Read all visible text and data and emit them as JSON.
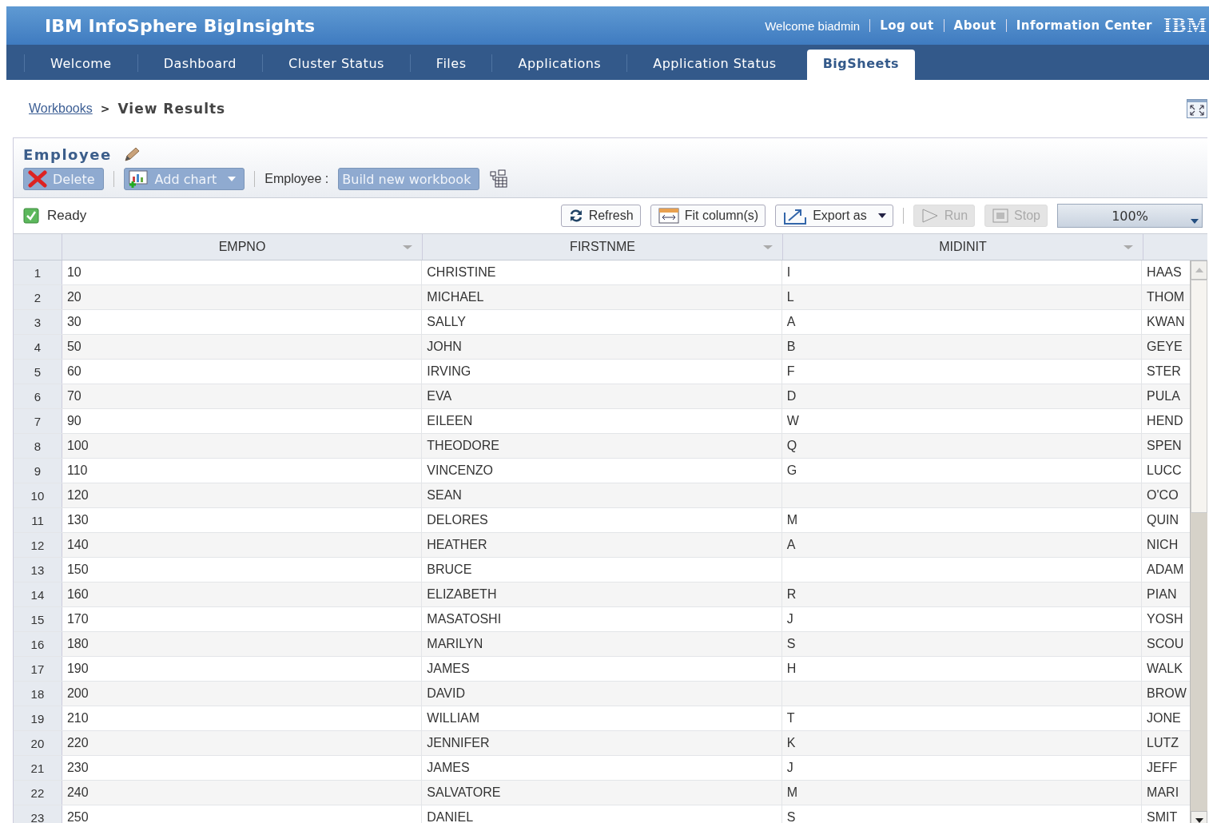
{
  "header": {
    "title": "IBM InfoSphere BigInsights",
    "welcome": "Welcome biadmin",
    "links": [
      "Log out",
      "About",
      "Information Center"
    ],
    "logo": "IBM"
  },
  "tabs": [
    {
      "label": "Welcome",
      "selected": false
    },
    {
      "label": "Dashboard",
      "selected": false
    },
    {
      "label": "Cluster Status",
      "selected": false
    },
    {
      "label": "Files",
      "selected": false
    },
    {
      "label": "Applications",
      "selected": false
    },
    {
      "label": "Application Status",
      "selected": false
    },
    {
      "label": "BigSheets",
      "selected": true
    }
  ],
  "breadcrumb": {
    "link": "Workbooks",
    "separator": ">",
    "current": "View Results"
  },
  "workbook": {
    "title": "Employee",
    "delete": "Delete",
    "add_chart": "Add chart",
    "source_label": "Employee :",
    "build": "Build new workbook"
  },
  "status": {
    "text": "Ready"
  },
  "actions": [
    {
      "kind": "refresh",
      "label": "Refresh",
      "disabled": false
    },
    {
      "kind": "fit",
      "label": "Fit column(s)",
      "disabled": false
    },
    {
      "kind": "export",
      "label": "Export as",
      "disabled": false
    },
    {
      "kind": "run",
      "label": "Run",
      "disabled": true
    },
    {
      "kind": "stop",
      "label": "Stop",
      "disabled": true
    }
  ],
  "zoom": "100%",
  "table": {
    "columns": [
      "EMPNO",
      "FIRSTNME",
      "MIDINIT"
    ],
    "rows": [
      {
        "num": "1",
        "empno": "10",
        "firstnme": "CHRISTINE",
        "midinit": "I",
        "column_4": "HAAS"
      },
      {
        "num": "2",
        "empno": "20",
        "firstnme": "MICHAEL",
        "midinit": "L",
        "column_4": "THOM"
      },
      {
        "num": "3",
        "empno": "30",
        "firstnme": "SALLY",
        "midinit": "A",
        "column_4": "KWAN"
      },
      {
        "num": "4",
        "empno": "50",
        "firstnme": "JOHN",
        "midinit": "B",
        "column_4": "GEYE"
      },
      {
        "num": "5",
        "empno": "60",
        "firstnme": "IRVING",
        "midinit": "F",
        "column_4": "STER"
      },
      {
        "num": "6",
        "empno": "70",
        "firstnme": "EVA",
        "midinit": "D",
        "column_4": "PULA"
      },
      {
        "num": "7",
        "empno": "90",
        "firstnme": "EILEEN",
        "midinit": "W",
        "column_4": "HEND"
      },
      {
        "num": "8",
        "empno": "100",
        "firstnme": "THEODORE",
        "midinit": "Q",
        "column_4": "SPEN"
      },
      {
        "num": "9",
        "empno": "110",
        "firstnme": "VINCENZO",
        "midinit": "G",
        "column_4": "LUCC"
      },
      {
        "num": "10",
        "empno": "120",
        "firstnme": "SEAN",
        "column_4": "O'CO"
      },
      {
        "num": "11",
        "empno": "130",
        "firstnme": "DELORES",
        "midinit": "M",
        "column_4": "QUIN"
      },
      {
        "num": "12",
        "empno": "140",
        "firstnme": "HEATHER",
        "midinit": "A",
        "column_4": "NICH"
      },
      {
        "num": "13",
        "empno": "150",
        "firstnme": "BRUCE",
        "column_4": "ADAM"
      },
      {
        "num": "14",
        "empno": "160",
        "firstnme": "ELIZABETH",
        "midinit": "R",
        "column_4": "PIAN"
      },
      {
        "num": "15",
        "empno": "170",
        "firstnme": "MASATOSHI",
        "midinit": "J",
        "column_4": "YOSH"
      },
      {
        "num": "16",
        "empno": "180",
        "firstnme": "MARILYN",
        "midinit": "S",
        "column_4": "SCOU"
      },
      {
        "num": "17",
        "empno": "190",
        "firstnme": "JAMES",
        "midinit": "H",
        "column_4": "WALK"
      },
      {
        "num": "18",
        "empno": "200",
        "firstnme": "DAVID",
        "column_4": "BROW"
      },
      {
        "num": "19",
        "empno": "210",
        "firstnme": "WILLIAM",
        "midinit": "T",
        "column_4": "JONE"
      },
      {
        "num": "20",
        "empno": "220",
        "firstnme": "JENNIFER",
        "midinit": "K",
        "column_4": "LUTZ"
      },
      {
        "num": "21",
        "empno": "230",
        "firstnme": "JAMES",
        "midinit": "J",
        "column_4": "JEFF"
      },
      {
        "num": "22",
        "empno": "240",
        "firstnme": "SALVATORE",
        "midinit": "M",
        "column_4": "MARI"
      },
      {
        "num": "23",
        "empno": "250",
        "firstnme": "DANIEL",
        "midinit": "S",
        "column_4": "SMIT"
      }
    ]
  }
}
